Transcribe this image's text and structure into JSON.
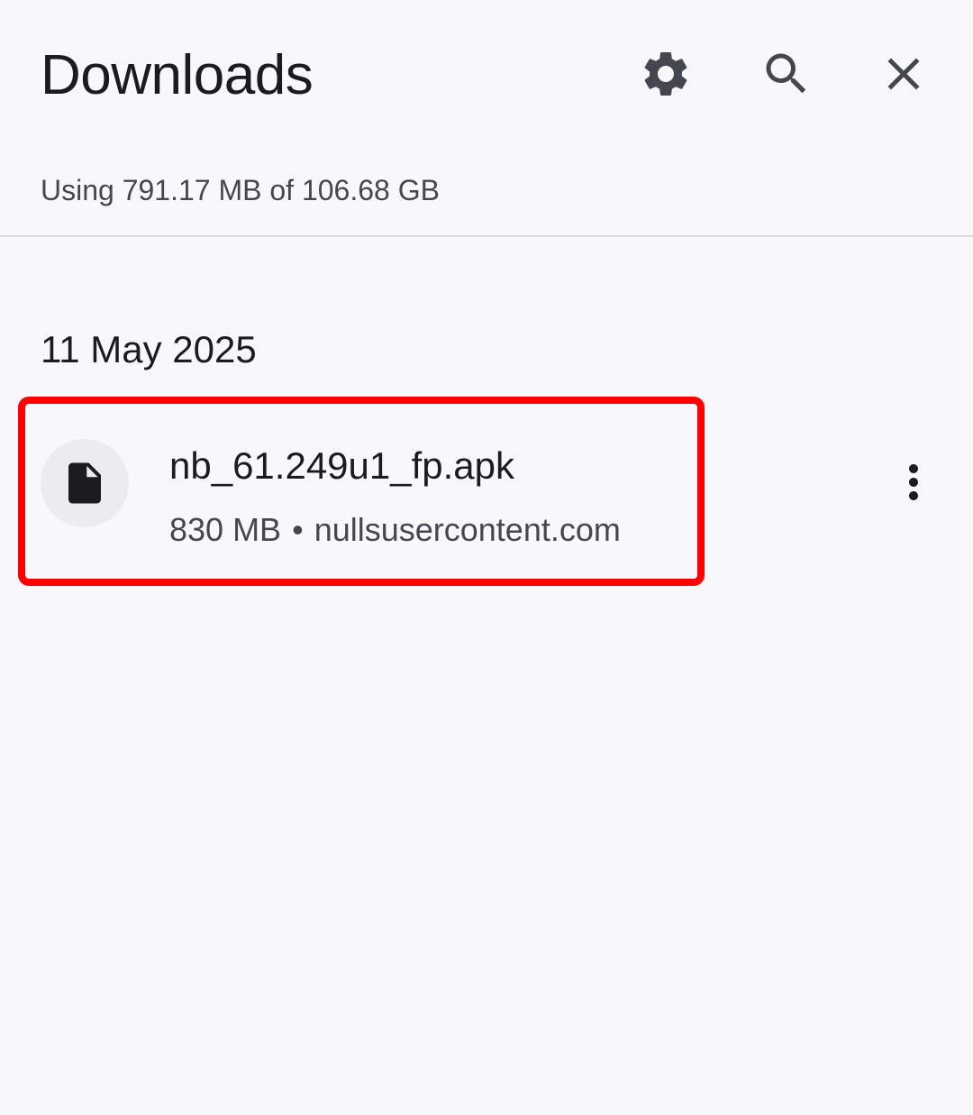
{
  "header": {
    "title": "Downloads",
    "actions": [
      {
        "name": "settings",
        "icon": "gear-icon"
      },
      {
        "name": "search",
        "icon": "search-icon"
      },
      {
        "name": "close",
        "icon": "close-icon"
      }
    ]
  },
  "storage": {
    "text": "Using 791.17 MB of 106.68 GB"
  },
  "groups": [
    {
      "date": "11 May 2025",
      "items": [
        {
          "file_name": "nb_61.249u1_fp.apk",
          "size": "830 MB",
          "separator": "•",
          "source": "nullsusercontent.com",
          "icon": "file-icon",
          "highlighted": true
        }
      ]
    }
  ],
  "colors": {
    "background": "#f8f8fc",
    "text_primary": "#1c1b1f",
    "text_secondary": "#47464f",
    "icon": "#45464f",
    "highlight": "#ff0000",
    "avatar_bg": "#ebebf0"
  }
}
